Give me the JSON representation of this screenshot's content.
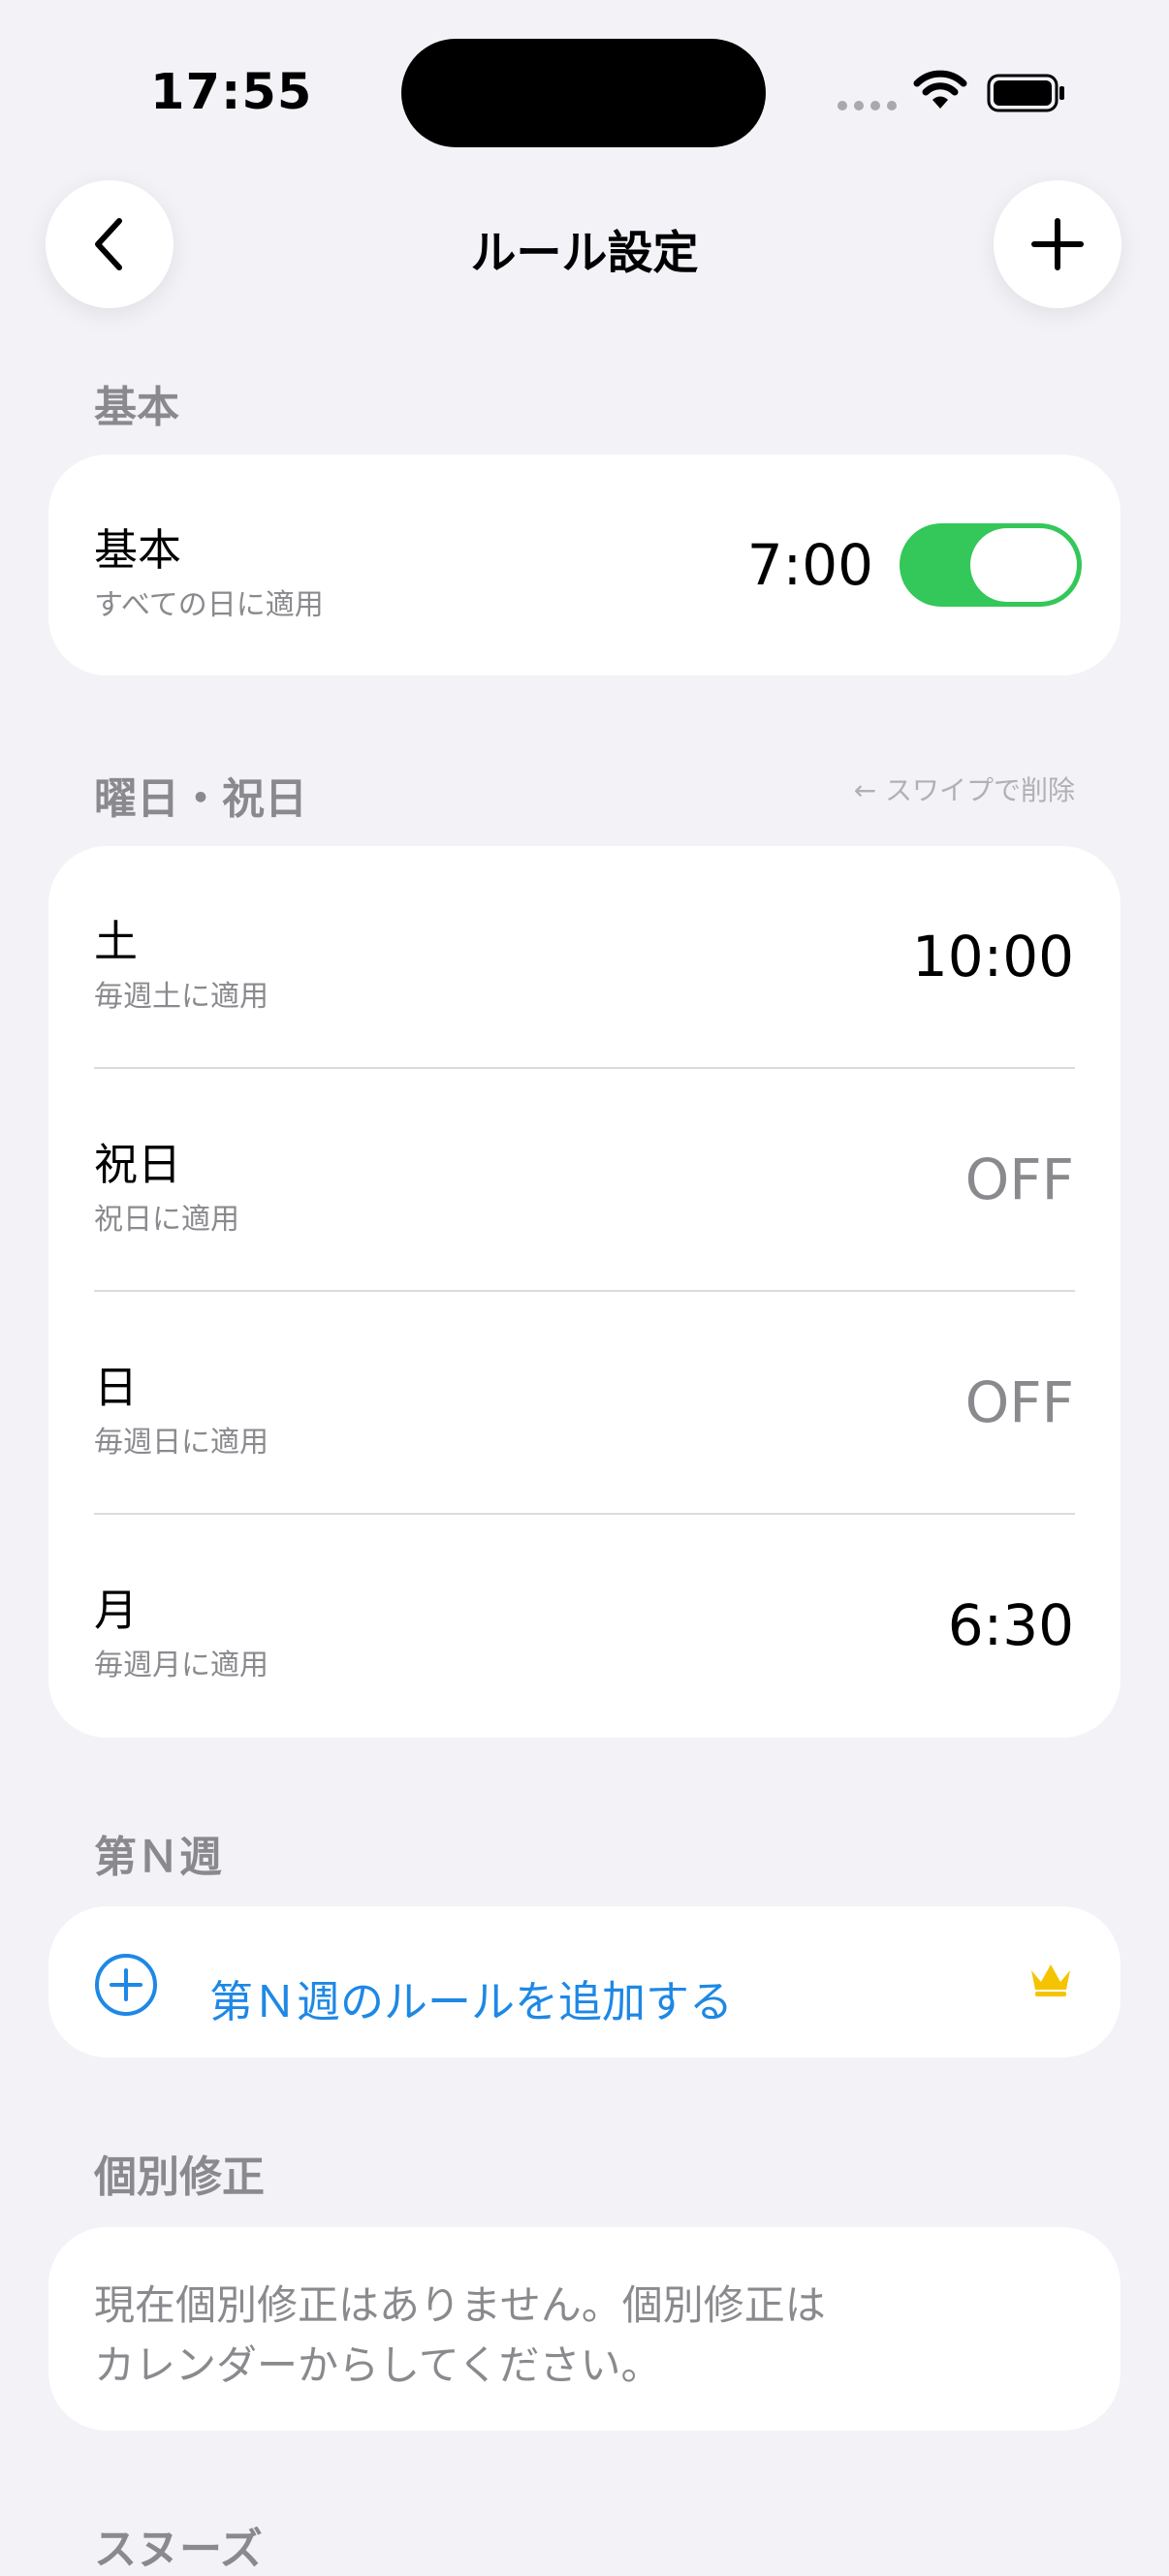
{
  "status_bar": {
    "time": "17:55"
  },
  "nav": {
    "title": "ルール設定"
  },
  "sections": {
    "basic": {
      "header": "基本",
      "row": {
        "title": "基本",
        "subtitle": "すべての日に適用",
        "time": "7:00",
        "enabled": true
      }
    },
    "weekday": {
      "header": "曜日・祝日",
      "hint": "← スワイプで削除",
      "rows": [
        {
          "title": "土",
          "subtitle": "毎週土に適用",
          "value": "10:00"
        },
        {
          "title": "祝日",
          "subtitle": "祝日に適用",
          "value": "OFF"
        },
        {
          "title": "日",
          "subtitle": "毎週日に適用",
          "value": "OFF"
        },
        {
          "title": "月",
          "subtitle": "毎週月に適用",
          "value": "6:30"
        }
      ]
    },
    "nth_week": {
      "header": "第Ｎ週",
      "add_label": "第Ｎ週のルールを追加する"
    },
    "individual": {
      "header": "個別修正",
      "empty_line1": "現在個別修正はありません。個別修正は",
      "empty_line2": "カレンダーからしてください。"
    },
    "snooze": {
      "header": "スヌーズ"
    }
  },
  "colors": {
    "accent": "#1e88e5",
    "toggle_on": "#34c759",
    "crown": "#f5c400",
    "background": "#f2f2f7",
    "secondary_text": "#8a8a8e"
  },
  "icons": [
    "back-chevron-icon",
    "plus-icon",
    "wifi-icon",
    "battery-icon",
    "add-circle-icon",
    "crown-icon"
  ]
}
